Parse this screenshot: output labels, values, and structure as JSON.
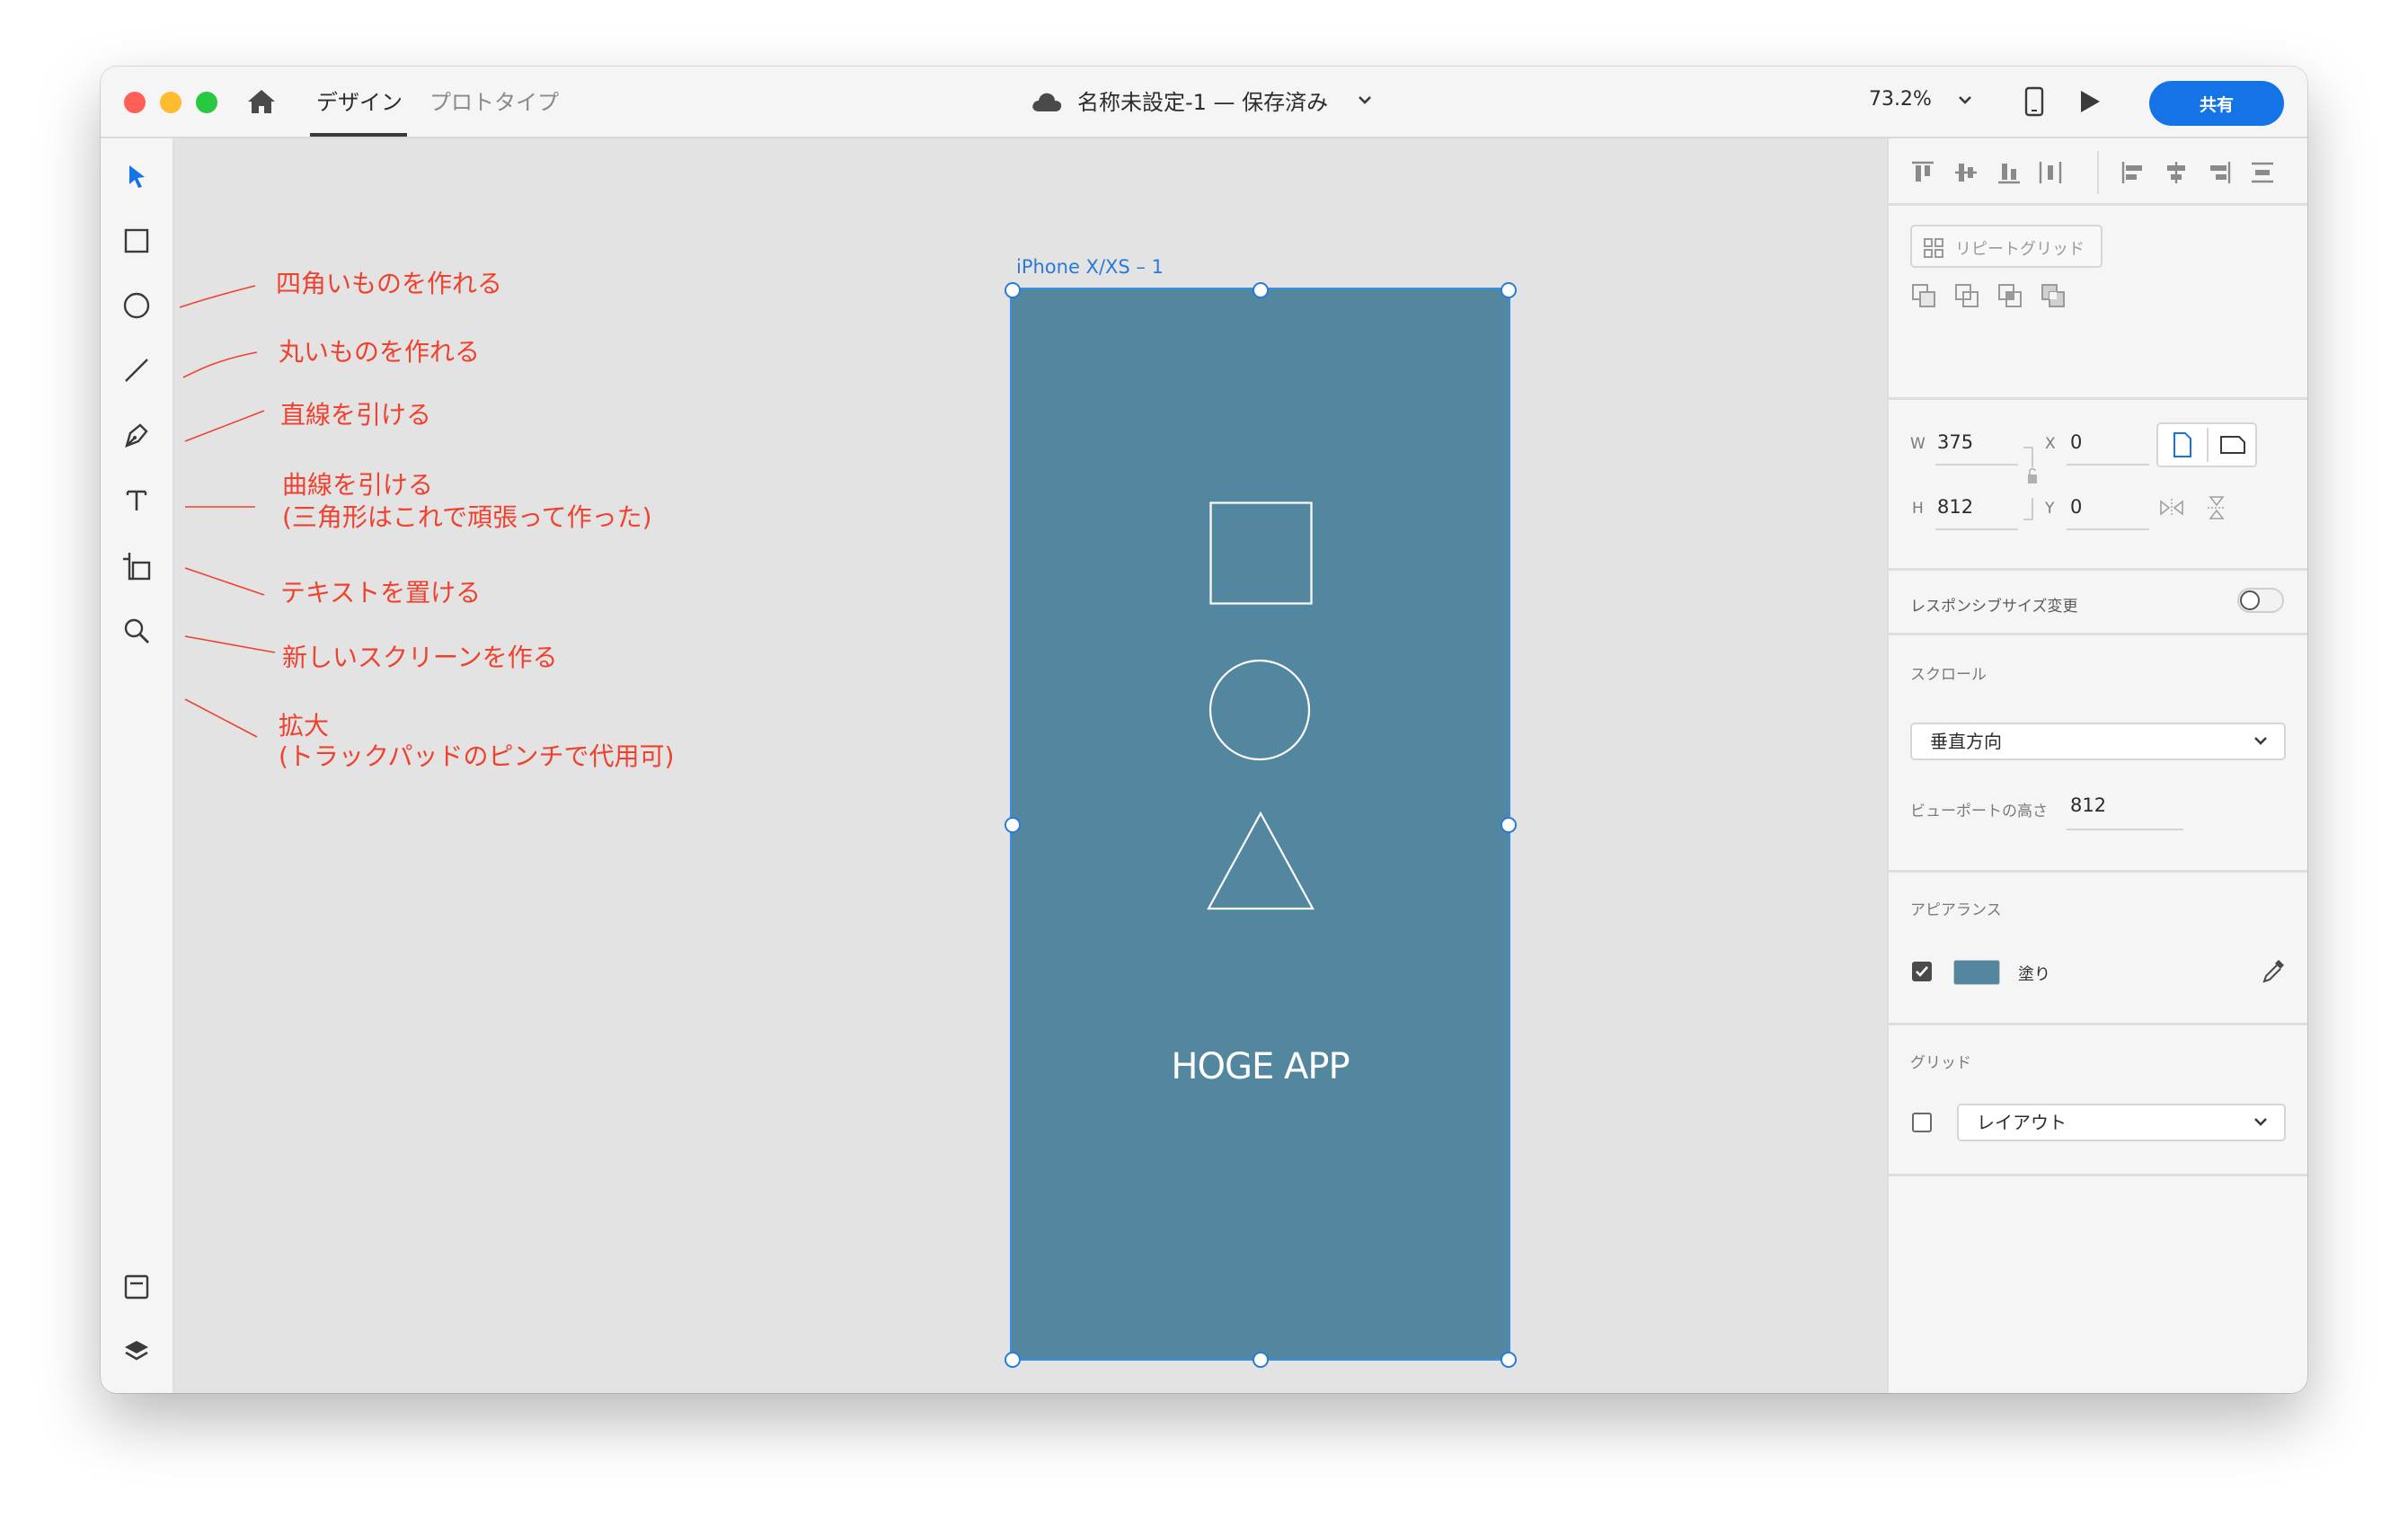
{
  "titlebar": {
    "tabs": [
      {
        "label": "デザイン"
      },
      {
        "label": "プロトタイプ"
      }
    ],
    "doc_title": "名称未設定-1 — 保存済み",
    "zoom": "73.2%",
    "share_label": "共有"
  },
  "toolbar": {
    "tools": [
      "select-tool",
      "rectangle-tool",
      "ellipse-tool",
      "line-tool",
      "pen-tool",
      "text-tool",
      "artboard-tool",
      "zoom-tool"
    ],
    "bottom": [
      "assets-panel",
      "layers-panel"
    ]
  },
  "annotations": [
    {
      "text": "四角いものを作れる"
    },
    {
      "text": "丸いものを作れる"
    },
    {
      "text": "直線を引ける"
    },
    {
      "text": "曲線を引ける"
    },
    {
      "text": "(三角形はこれで頑張って作った)"
    },
    {
      "text": "テキストを置ける"
    },
    {
      "text": "新しいスクリーンを作る"
    },
    {
      "text": "拡大"
    },
    {
      "text": "(トラックパッドのピンチで代用可)"
    }
  ],
  "artboard": {
    "label": "iPhone X/XS – 1",
    "app_title": "HOGE APP",
    "fill_color": "#53879f"
  },
  "panel": {
    "repeat_grid": "リピートグリッド",
    "w_label": "W",
    "w_value": "375",
    "h_label": "H",
    "h_value": "812",
    "x_label": "X",
    "x_value": "0",
    "y_label": "Y",
    "y_value": "0",
    "responsive_label": "レスポンシブサイズ変更",
    "scroll_section": "スクロール",
    "scroll_value": "垂直方向",
    "viewport_label": "ビューポートの高さ",
    "viewport_value": "812",
    "appearance_section": "アピアランス",
    "fill_label": "塗り",
    "grid_section": "グリッド",
    "grid_value": "レイアウト"
  },
  "colors": {
    "accent": "#1473e6",
    "annotation": "#f0412f",
    "artboard": "#53879f"
  }
}
